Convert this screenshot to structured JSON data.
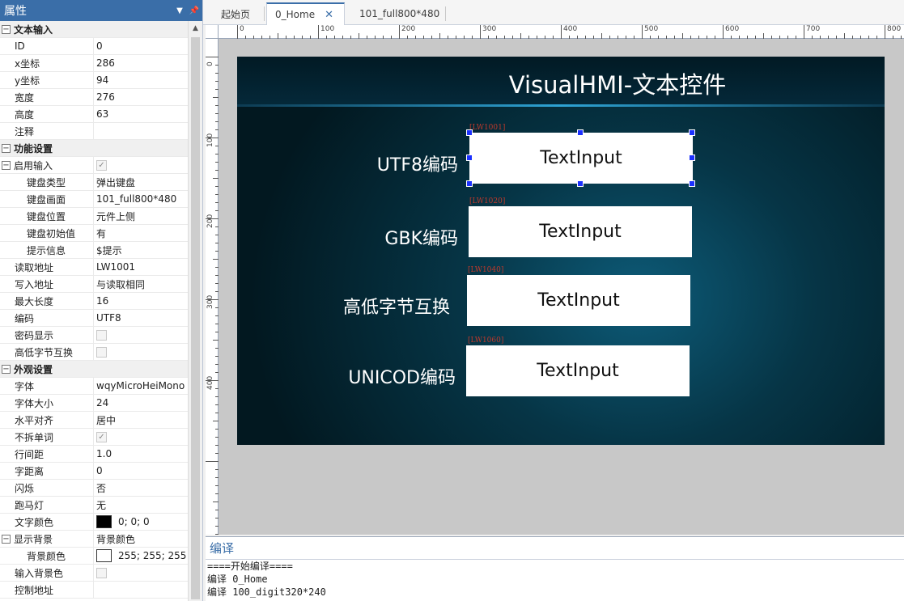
{
  "properties_panel": {
    "title": "属性",
    "pin_icon": "pin-icon",
    "dropdown_icon": "chevron-down-icon",
    "groups": [
      {
        "type": "group",
        "label": "文本输入",
        "expanded": true
      },
      {
        "type": "row",
        "name": "ID",
        "value": "0"
      },
      {
        "type": "row",
        "name": "x坐标",
        "value": "286"
      },
      {
        "type": "row",
        "name": "y坐标",
        "value": "94"
      },
      {
        "type": "row",
        "name": "宽度",
        "value": "276"
      },
      {
        "type": "row",
        "name": "高度",
        "value": "63"
      },
      {
        "type": "row",
        "name": "注释",
        "value": ""
      },
      {
        "type": "group",
        "label": "功能设置",
        "expanded": true
      },
      {
        "type": "exprow",
        "name": "启用输入",
        "check": true
      },
      {
        "type": "subrow",
        "name": "键盘类型",
        "value": "弹出键盘"
      },
      {
        "type": "subrow",
        "name": "键盘画面",
        "value": "101_full800*480"
      },
      {
        "type": "subrow",
        "name": "键盘位置",
        "value": "元件上侧"
      },
      {
        "type": "subrow",
        "name": "键盘初始值",
        "value": "有"
      },
      {
        "type": "subrow",
        "name": "提示信息",
        "value": "$提示"
      },
      {
        "type": "row",
        "name": "读取地址",
        "value": "LW1001"
      },
      {
        "type": "row",
        "name": "写入地址",
        "value": "与读取相同"
      },
      {
        "type": "row",
        "name": "最大长度",
        "value": "16"
      },
      {
        "type": "row",
        "name": "编码",
        "value": "UTF8"
      },
      {
        "type": "row",
        "name": "密码显示",
        "check": false
      },
      {
        "type": "row",
        "name": "高低字节互换",
        "check": false
      },
      {
        "type": "group",
        "label": "外观设置",
        "expanded": true
      },
      {
        "type": "row",
        "name": "字体",
        "value": "wqyMicroHeiMono"
      },
      {
        "type": "row",
        "name": "字体大小",
        "value": "24"
      },
      {
        "type": "row",
        "name": "水平对齐",
        "value": "居中"
      },
      {
        "type": "row",
        "name": "不拆单词",
        "check": true
      },
      {
        "type": "row",
        "name": "行间距",
        "value": "1.0"
      },
      {
        "type": "row",
        "name": "字距离",
        "value": "0"
      },
      {
        "type": "row",
        "name": "闪烁",
        "value": "否"
      },
      {
        "type": "row",
        "name": "跑马灯",
        "value": "无"
      },
      {
        "type": "row",
        "name": "文字颜色",
        "value": "0; 0; 0",
        "color": "#000000"
      },
      {
        "type": "exprow",
        "name": "显示背景",
        "value": "背景颜色"
      },
      {
        "type": "subrow",
        "name": "背景颜色",
        "value": "255; 255; 255",
        "color": "#ffffff"
      },
      {
        "type": "row",
        "name": "输入背景色",
        "check": false
      },
      {
        "type": "row",
        "name": "控制地址",
        "value": ""
      }
    ]
  },
  "tabs": [
    {
      "label": "起始页",
      "active": false
    },
    {
      "label": "0_Home",
      "active": true,
      "closable": true
    },
    {
      "label": "101_full800*480",
      "active": false
    }
  ],
  "ruler": {
    "top_labels": [
      "0",
      "100",
      "200",
      "300",
      "400",
      "500",
      "600",
      "700",
      "800"
    ],
    "left_labels": [
      "0",
      "100",
      "200",
      "300",
      "400"
    ]
  },
  "hmi": {
    "title": "VisualHMI-文本控件",
    "rows": [
      {
        "label": "UTF8编码",
        "input_text": "TextInput",
        "address": "[LW1001]",
        "selected": true
      },
      {
        "label": "GBK编码",
        "input_text": "TextInput",
        "address": "[LW1020]",
        "selected": false
      },
      {
        "label": "高低字节互换",
        "input_text": "TextInput",
        "address": "[LW1040]",
        "selected": false
      },
      {
        "label": "UNICOD编码",
        "input_text": "TextInput",
        "address": "[LW1060]",
        "selected": false
      }
    ]
  },
  "output": {
    "title": "编译",
    "lines": [
      "====开始编译====",
      "编译 0_Home",
      "编译 100_digit320*240"
    ]
  },
  "colors": {
    "accent": "#3a6ea8",
    "selection_handle": "#1b30ff",
    "address_text": "#c0392b"
  }
}
